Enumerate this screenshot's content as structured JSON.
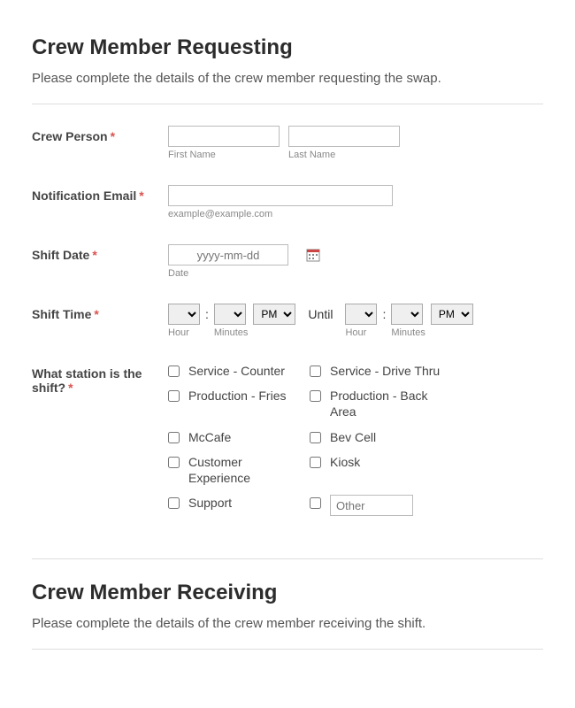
{
  "section1": {
    "heading": "Crew Member Requesting",
    "desc": "Please complete the details of the crew member requesting the swap."
  },
  "crewPerson": {
    "label": "Crew Person",
    "first_sublabel": "First Name",
    "last_sublabel": "Last Name"
  },
  "email": {
    "label": "Notification Email",
    "sublabel": "example@example.com"
  },
  "shiftDate": {
    "label": "Shift Date",
    "placeholder": "yyyy-mm-dd",
    "sublabel": "Date"
  },
  "shiftTime": {
    "label": "Shift Time",
    "hour_lbl": "Hour",
    "min_lbl": "Minutes",
    "until": "Until",
    "ampm": "PM"
  },
  "station": {
    "label": "What station is the shift?",
    "options": {
      "o1": "Service - Counter",
      "o2": "Service - Drive Thru",
      "o3": "Production - Fries",
      "o4": "Production - Back Area",
      "o5": "McCafe",
      "o6": "Bev Cell",
      "o7": "Customer Experience",
      "o8": "Kiosk",
      "o9": "Support",
      "other_placeholder": "Other"
    }
  },
  "section2": {
    "heading": "Crew Member Receiving",
    "desc": "Please complete the details of the crew member receiving the shift."
  }
}
